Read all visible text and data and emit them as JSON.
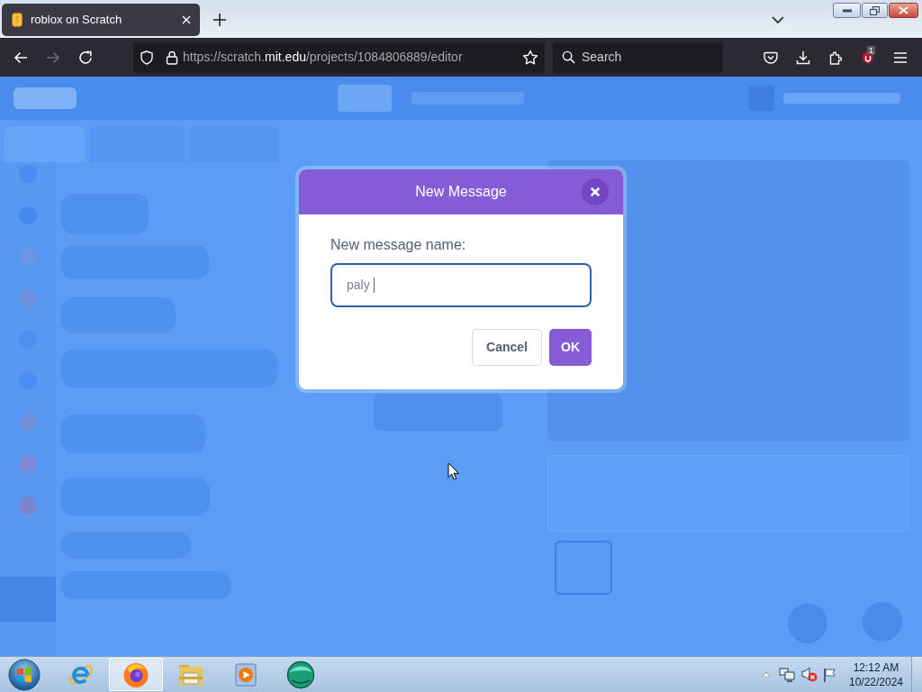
{
  "browser": {
    "tabs": [
      {
        "title": "roblox on Scratch",
        "selected": true
      }
    ],
    "nav_buttons": [
      {
        "kind": "back",
        "disabled": false
      },
      {
        "kind": "forward",
        "disabled": true
      },
      {
        "kind": "reload",
        "disabled": false
      }
    ],
    "url_parts": [
      {
        "text": "https://scratch.",
        "highlight": false
      },
      {
        "text": "mit.edu",
        "highlight": true
      },
      {
        "text": "/projects/1084806889/editor",
        "highlight": false
      }
    ],
    "search": {
      "placeholder": "Search"
    },
    "toolbar_icons": [
      {
        "kind": "pocket"
      },
      {
        "kind": "download"
      },
      {
        "kind": "extensions"
      },
      {
        "kind": "addon",
        "badge": "1"
      },
      {
        "kind": "menu"
      }
    ]
  },
  "editor": {
    "tabs": [
      {
        "selected": true
      },
      {
        "selected": false
      },
      {
        "selected": false
      }
    ]
  },
  "dialog": {
    "title": "New Message",
    "label": "New message name:",
    "field": {
      "value": "paly",
      "focused": true
    },
    "buttons": [
      {
        "label": "Cancel",
        "kind": "secondary"
      },
      {
        "label": "OK",
        "kind": "primary"
      }
    ]
  },
  "taskbar": {
    "apps": [
      {
        "kind": "e_globe",
        "selected": false
      },
      {
        "kind": "flame_globe",
        "selected": true
      },
      {
        "kind": "folder",
        "selected": false
      },
      {
        "kind": "player",
        "selected": false
      },
      {
        "kind": "sphere",
        "selected": false
      }
    ],
    "tray": {
      "volume_muted": true
    },
    "clock": {
      "time": "12:12 AM",
      "date": "10/22/2024"
    }
  }
}
